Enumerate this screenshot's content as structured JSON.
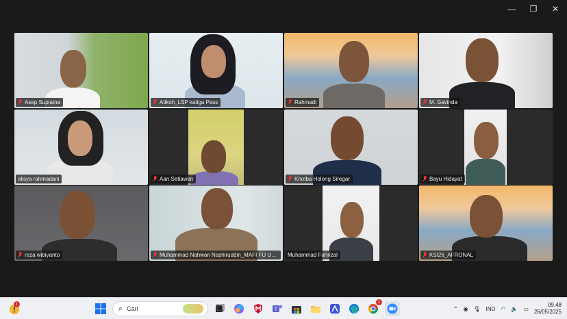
{
  "window_controls": {
    "minimize": "—",
    "restore": "❐",
    "close": "✕"
  },
  "participants": [
    {
      "name": "Asep Supiatna",
      "muted": true
    },
    {
      "name": "Atikoh_LSP katiga Pass",
      "muted": true,
      "active_speaker": true
    },
    {
      "name": "Rahmadi",
      "muted": true
    },
    {
      "name": "M. Gavinda",
      "muted": true
    },
    {
      "name": "alisya rahmadani",
      "muted": false
    },
    {
      "name": "Aan Setiawan",
      "muted": true
    },
    {
      "name": "Khotba Holong Siregar",
      "muted": true
    },
    {
      "name": "Bayu Hidayat",
      "muted": true
    },
    {
      "name": "reza wibiyanto",
      "muted": true
    },
    {
      "name": "Muhammad Nahwan Nashiruddin_MAFI FU UIN...",
      "muted": true
    },
    {
      "name": "Muhammad Fahrizal",
      "muted": false
    },
    {
      "name": "KSI26_AFRONAL",
      "muted": true
    }
  ],
  "taskbar": {
    "notification_count": "1",
    "search_placeholder": "Cari",
    "apps": [
      "windows-start",
      "search",
      "task-view",
      "copilot",
      "mcafee",
      "teams",
      "store",
      "file-explorer",
      "stream",
      "edge",
      "chrome",
      "zoom"
    ],
    "chrome_badge": "1",
    "tray": {
      "language": "IND",
      "time": "09.48",
      "date": "26/05/2025"
    }
  },
  "colors": {
    "active_outline": "#3ccf8e",
    "muted_icon": "#e33333",
    "taskbar_bg": "#eef0f3"
  }
}
